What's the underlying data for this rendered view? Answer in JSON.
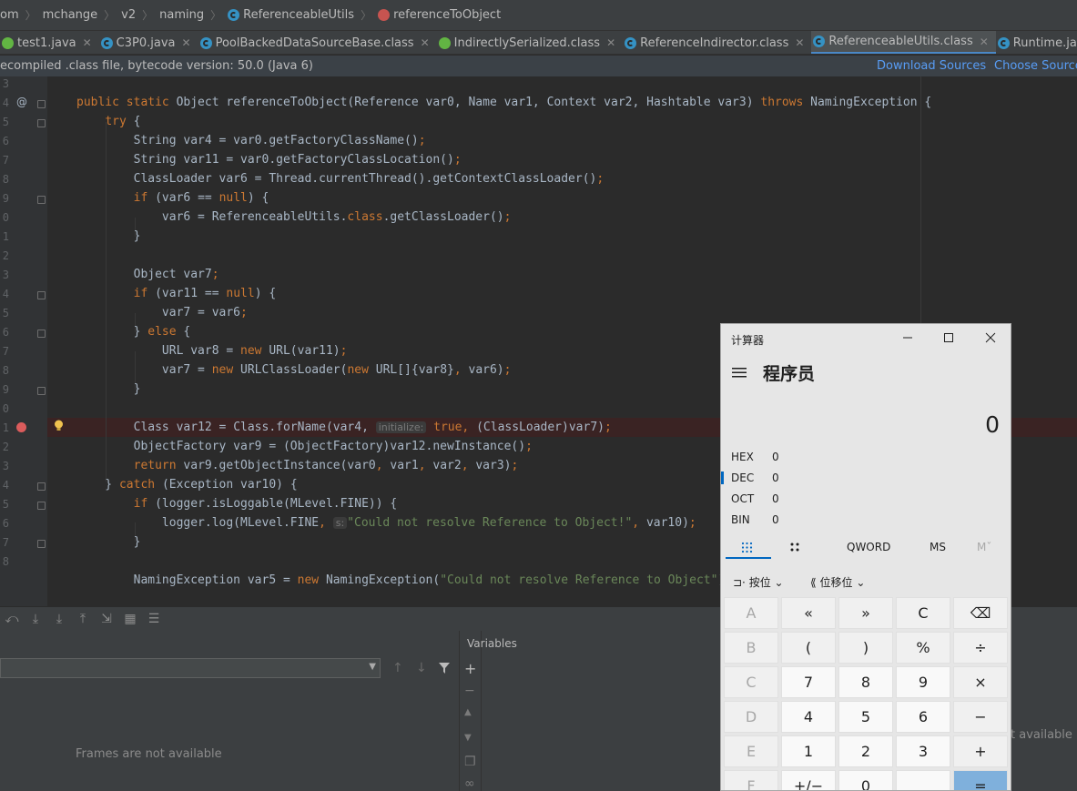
{
  "breadcrumb": {
    "items": [
      {
        "label": "om",
        "icon": ""
      },
      {
        "label": "mchange",
        "icon": ""
      },
      {
        "label": "v2",
        "icon": ""
      },
      {
        "label": "naming",
        "icon": ""
      },
      {
        "label": "ReferenceableUtils",
        "icon": "class-icon"
      },
      {
        "label": "referenceToObject",
        "icon": "method-icon"
      }
    ]
  },
  "tabs": [
    {
      "label": "test1.java",
      "icon": "java-class-icon"
    },
    {
      "label": "C3P0.java",
      "icon": "class-icon"
    },
    {
      "label": "PoolBackedDataSourceBase.class",
      "icon": "class-icon"
    },
    {
      "label": "IndirectlySerialized.class",
      "icon": "interface-icon"
    },
    {
      "label": "ReferenceIndirector.class",
      "icon": "class-icon"
    },
    {
      "label": "ReferenceableUtils.class",
      "icon": "class-icon"
    },
    {
      "label": "Runtime.java",
      "icon": "class-icon"
    }
  ],
  "banner": {
    "message": "ecompiled .class file, bytecode version: 50.0 (Java 6)",
    "download_sources": "Download Sources",
    "choose_sources": "Choose Sources..."
  },
  "editor": {
    "line_numbers": [
      "3",
      "4",
      "5",
      "6",
      "7",
      "8",
      "9",
      "0",
      "1",
      "2",
      "3",
      "4",
      "5",
      "6",
      "7",
      "8",
      "9",
      "0",
      "1",
      "2",
      "3",
      "4",
      "5",
      "6",
      "7",
      "8"
    ],
    "breakpoint_line": "Class var12 = Class.forName(var4,",
    "hint_initialize": "initialize:",
    "hint_s": "s:",
    "annotation_marker": "@"
  },
  "debug": {
    "frames_empty": "Frames are not available",
    "variables_title": "Variables",
    "variables_empty": "t available"
  },
  "calculator": {
    "title": "计算器",
    "mode": "程序员",
    "display": "0",
    "radix": [
      {
        "name": "HEX",
        "value": "0"
      },
      {
        "name": "DEC",
        "value": "0"
      },
      {
        "name": "OCT",
        "value": "0"
      },
      {
        "name": "BIN",
        "value": "0"
      }
    ],
    "tabs": {
      "word": "QWORD",
      "ms": "MS",
      "m": "Mˇ"
    },
    "dropdowns": {
      "bitwise": "按位",
      "bitshift": "位移位"
    },
    "keys": [
      [
        "A",
        "«",
        "»",
        "C",
        "⌫"
      ],
      [
        "B",
        "(",
        ")",
        "%",
        "÷"
      ],
      [
        "C",
        "7",
        "8",
        "9",
        "×"
      ],
      [
        "D",
        "4",
        "5",
        "6",
        "−"
      ],
      [
        "E",
        "1",
        "2",
        "3",
        "+"
      ],
      [
        "F",
        "+/−",
        "0",
        "",
        "="
      ]
    ],
    "accent_color": "#0067c0"
  },
  "colors": {
    "keyword": "#cc7832",
    "string": "#6a8759",
    "text": "#a9b7c6",
    "background": "#2b2b2b",
    "breakpoint": "#db5c5c"
  }
}
